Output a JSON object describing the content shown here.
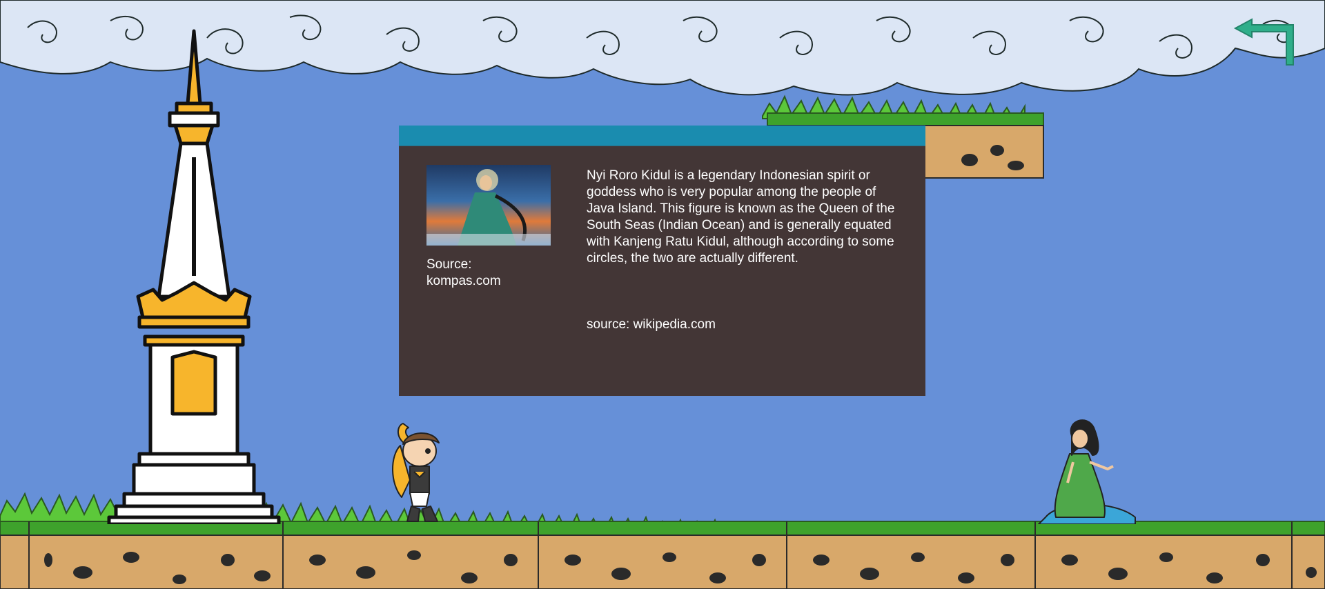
{
  "info_panel": {
    "image_alt": "Nyi Roro Kidul illustration",
    "image_caption": "Source:\nkompas.com",
    "description": "Nyi Roro Kidul is a legendary Indonesian spirit or goddess who is very popular among the people of Java Island. This figure is known as the Queen of the South Seas (Indian Ocean) and is generally equated with Kanjeng Ratu Kidul, although according to some circles, the two are actually different.",
    "source": "source: wikipedia.com"
  },
  "controls": {
    "back_icon": "back-arrow-icon"
  },
  "colors": {
    "sky": "#6690d8",
    "panel_bg": "#433636",
    "panel_header": "#1a8caf",
    "grass": "#5cc83a",
    "dirt": "#d8a86a",
    "monument_gold": "#f7b52c",
    "back_arrow": "#2fae8a"
  }
}
